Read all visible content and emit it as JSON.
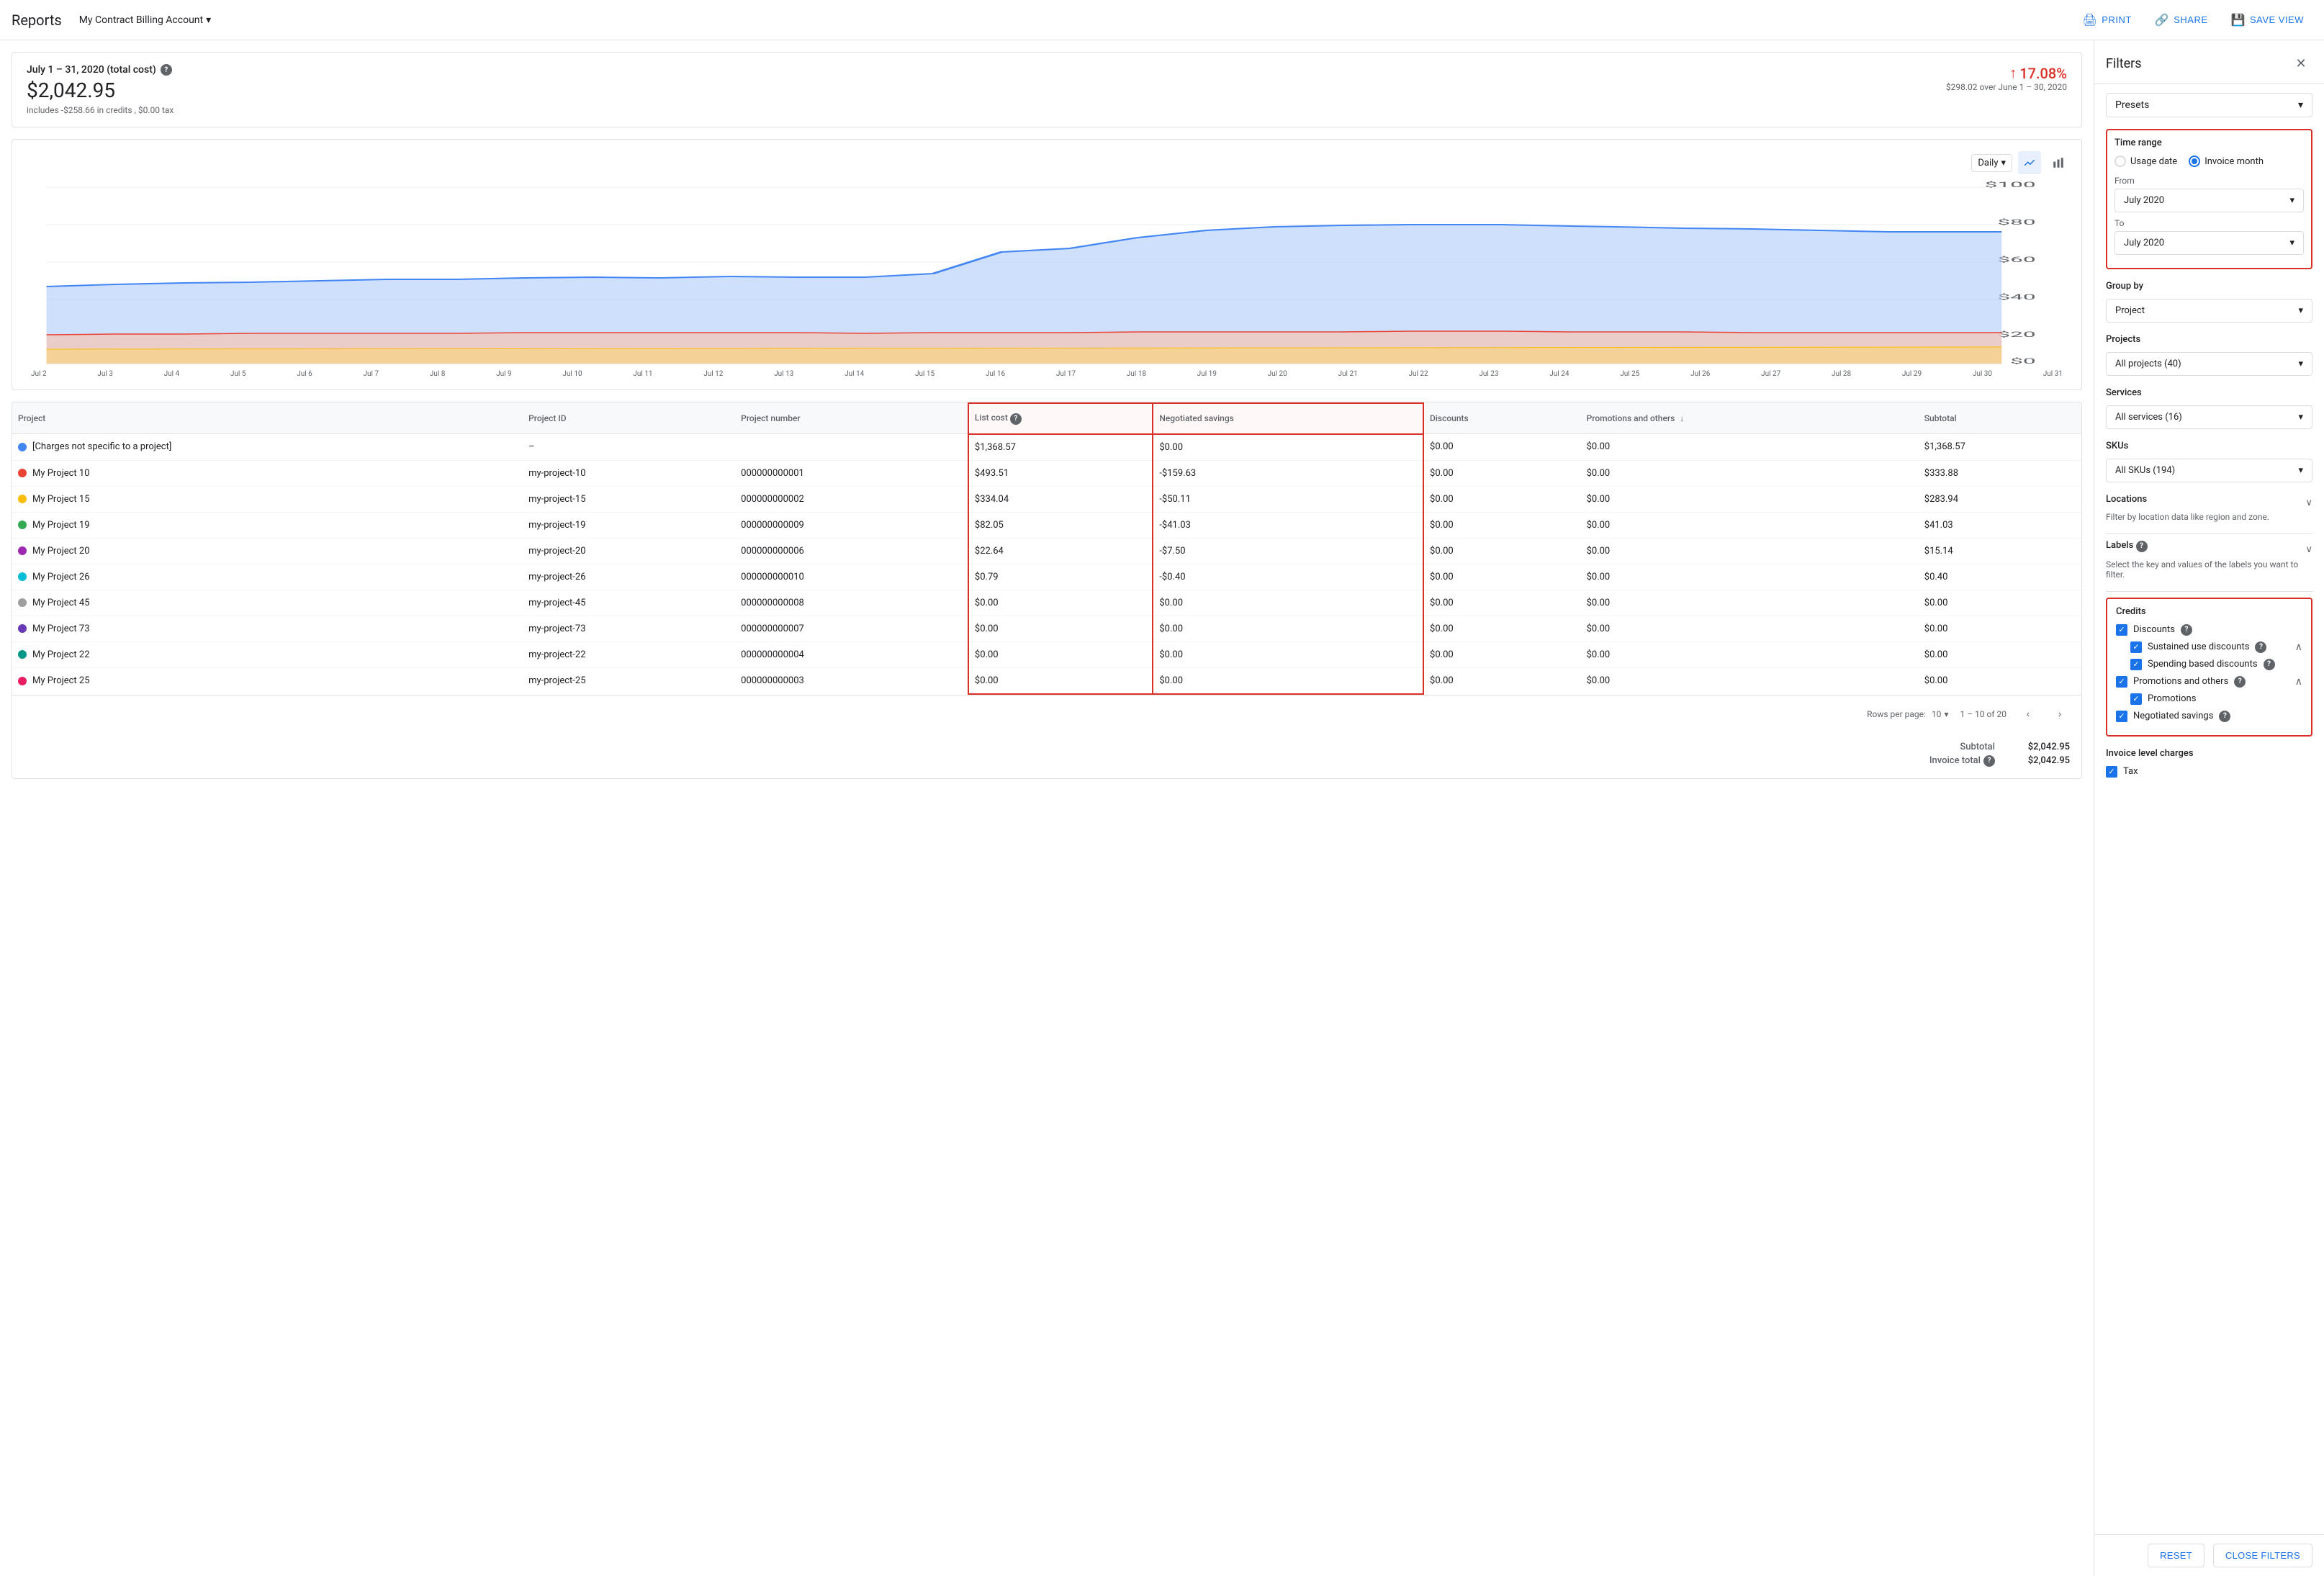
{
  "header": {
    "title": "Reports",
    "account": "My Contract Billing Account",
    "actions": {
      "print": "PRINT",
      "share": "SHARE",
      "save_view": "SAVE VIEW"
    }
  },
  "summary": {
    "date_range": "July 1 – 31, 2020 (total cost)",
    "amount": "$2,042.95",
    "credits_note": "includes -$258.66 in credits , $0.00 tax",
    "change_pct": "17.08%",
    "change_desc": "$298.02 over June 1 – 30, 2020"
  },
  "chart": {
    "period": "Daily",
    "y_labels": [
      "$100",
      "$80",
      "$60",
      "$40",
      "$20",
      "$0"
    ],
    "x_labels": [
      "Jul 2",
      "Jul 3",
      "Jul 4",
      "Jul 5",
      "Jul 6",
      "Jul 7",
      "Jul 8",
      "Jul 9",
      "Jul 10",
      "Jul 11",
      "Jul 12",
      "Jul 13",
      "Jul 14",
      "Jul 15",
      "Jul 16",
      "Jul 17",
      "Jul 18",
      "Jul 19",
      "Jul 20",
      "Jul 21",
      "Jul 22",
      "Jul 23",
      "Jul 24",
      "Jul 25",
      "Jul 26",
      "Jul 27",
      "Jul 28",
      "Jul 29",
      "Jul 30",
      "Jul 31"
    ]
  },
  "table": {
    "columns": [
      "Project",
      "Project ID",
      "Project number",
      "List cost",
      "Negotiated savings",
      "Discounts",
      "Promotions and others",
      "Subtotal"
    ],
    "rows": [
      {
        "project": "[Charges not specific to a project]",
        "dot_color": "#4285f4",
        "project_id": "–",
        "project_number": "",
        "list_cost": "$1,368.57",
        "negotiated_savings": "$0.00",
        "discounts": "$0.00",
        "promotions": "$0.00",
        "subtotal": "$1,368.57"
      },
      {
        "project": "My Project 10",
        "dot_color": "#ea4335",
        "project_id": "my-project-10",
        "project_number": "000000000001",
        "list_cost": "$493.51",
        "negotiated_savings": "-$159.63",
        "discounts": "$0.00",
        "promotions": "$0.00",
        "subtotal": "$333.88"
      },
      {
        "project": "My Project 15",
        "dot_color": "#fbbc04",
        "project_id": "my-project-15",
        "project_number": "000000000002",
        "list_cost": "$334.04",
        "negotiated_savings": "-$50.11",
        "discounts": "$0.00",
        "promotions": "$0.00",
        "subtotal": "$283.94"
      },
      {
        "project": "My Project 19",
        "dot_color": "#34a853",
        "project_id": "my-project-19",
        "project_number": "000000000009",
        "list_cost": "$82.05",
        "negotiated_savings": "-$41.03",
        "discounts": "$0.00",
        "promotions": "$0.00",
        "subtotal": "$41.03"
      },
      {
        "project": "My Project 20",
        "dot_color": "#9c27b0",
        "project_id": "my-project-20",
        "project_number": "000000000006",
        "list_cost": "$22.64",
        "negotiated_savings": "-$7.50",
        "discounts": "$0.00",
        "promotions": "$0.00",
        "subtotal": "$15.14"
      },
      {
        "project": "My Project 26",
        "dot_color": "#00bcd4",
        "project_id": "my-project-26",
        "project_number": "000000000010",
        "list_cost": "$0.79",
        "negotiated_savings": "-$0.40",
        "discounts": "$0.00",
        "promotions": "$0.00",
        "subtotal": "$0.40"
      },
      {
        "project": "My Project 45",
        "dot_color": "#9e9e9e",
        "project_id": "my-project-45",
        "project_number": "000000000008",
        "list_cost": "$0.00",
        "negotiated_savings": "$0.00",
        "discounts": "$0.00",
        "promotions": "$0.00",
        "subtotal": "$0.00"
      },
      {
        "project": "My Project 73",
        "dot_color": "#673ab7",
        "project_id": "my-project-73",
        "project_number": "000000000007",
        "list_cost": "$0.00",
        "negotiated_savings": "$0.00",
        "discounts": "$0.00",
        "promotions": "$0.00",
        "subtotal": "$0.00"
      },
      {
        "project": "My Project 22",
        "dot_color": "#009688",
        "project_id": "my-project-22",
        "project_number": "000000000004",
        "list_cost": "$0.00",
        "negotiated_savings": "$0.00",
        "discounts": "$0.00",
        "promotions": "$0.00",
        "subtotal": "$0.00"
      },
      {
        "project": "My Project 25",
        "dot_color": "#e91e63",
        "project_id": "my-project-25",
        "project_number": "000000000003",
        "list_cost": "$0.00",
        "negotiated_savings": "$0.00",
        "discounts": "$0.00",
        "promotions": "$0.00",
        "subtotal": "$0.00"
      }
    ],
    "rows_per_page_label": "Rows per page:",
    "rows_per_page": "10",
    "pagination": "1 – 10 of 20",
    "subtotal_label": "Subtotal",
    "subtotal_value": "$2,042.95",
    "invoice_total_label": "Invoice total",
    "invoice_total_value": "$2,042.95"
  },
  "filters": {
    "title": "Filters",
    "presets_label": "Presets",
    "time_range": {
      "section_title": "Time range",
      "usage_date": "Usage date",
      "invoice_month": "Invoice month",
      "selected": "invoice_month",
      "from_label": "From",
      "from_value": "July 2020",
      "to_label": "To",
      "to_value": "July 2020"
    },
    "group_by": {
      "section_title": "Group by",
      "value": "Project"
    },
    "projects": {
      "section_title": "Projects",
      "value": "All projects (40)"
    },
    "services": {
      "section_title": "Services",
      "value": "All services (16)"
    },
    "skus": {
      "section_title": "SKUs",
      "value": "All SKUs (194)"
    },
    "locations": {
      "section_title": "Locations",
      "description": "Filter by location data like region and zone."
    },
    "labels": {
      "section_title": "Labels",
      "description": "Select the key and values of the labels you want to filter."
    },
    "credits": {
      "section_title": "Credits",
      "discounts_label": "Discounts",
      "discounts_checked": true,
      "sustained_use_label": "Sustained use discounts",
      "sustained_use_checked": true,
      "spending_based_label": "Spending based discounts",
      "spending_based_checked": true,
      "promotions_and_others_label": "Promotions and others",
      "promotions_and_others_checked": true,
      "promotions_label": "Promotions",
      "promotions_checked": true,
      "negotiated_savings_label": "Negotiated savings",
      "negotiated_savings_checked": true
    },
    "invoice_charges": {
      "section_title": "Invoice level charges",
      "tax_label": "Tax",
      "tax_checked": true
    },
    "reset_label": "RESET",
    "close_label": "CLOSE FILTERS"
  }
}
